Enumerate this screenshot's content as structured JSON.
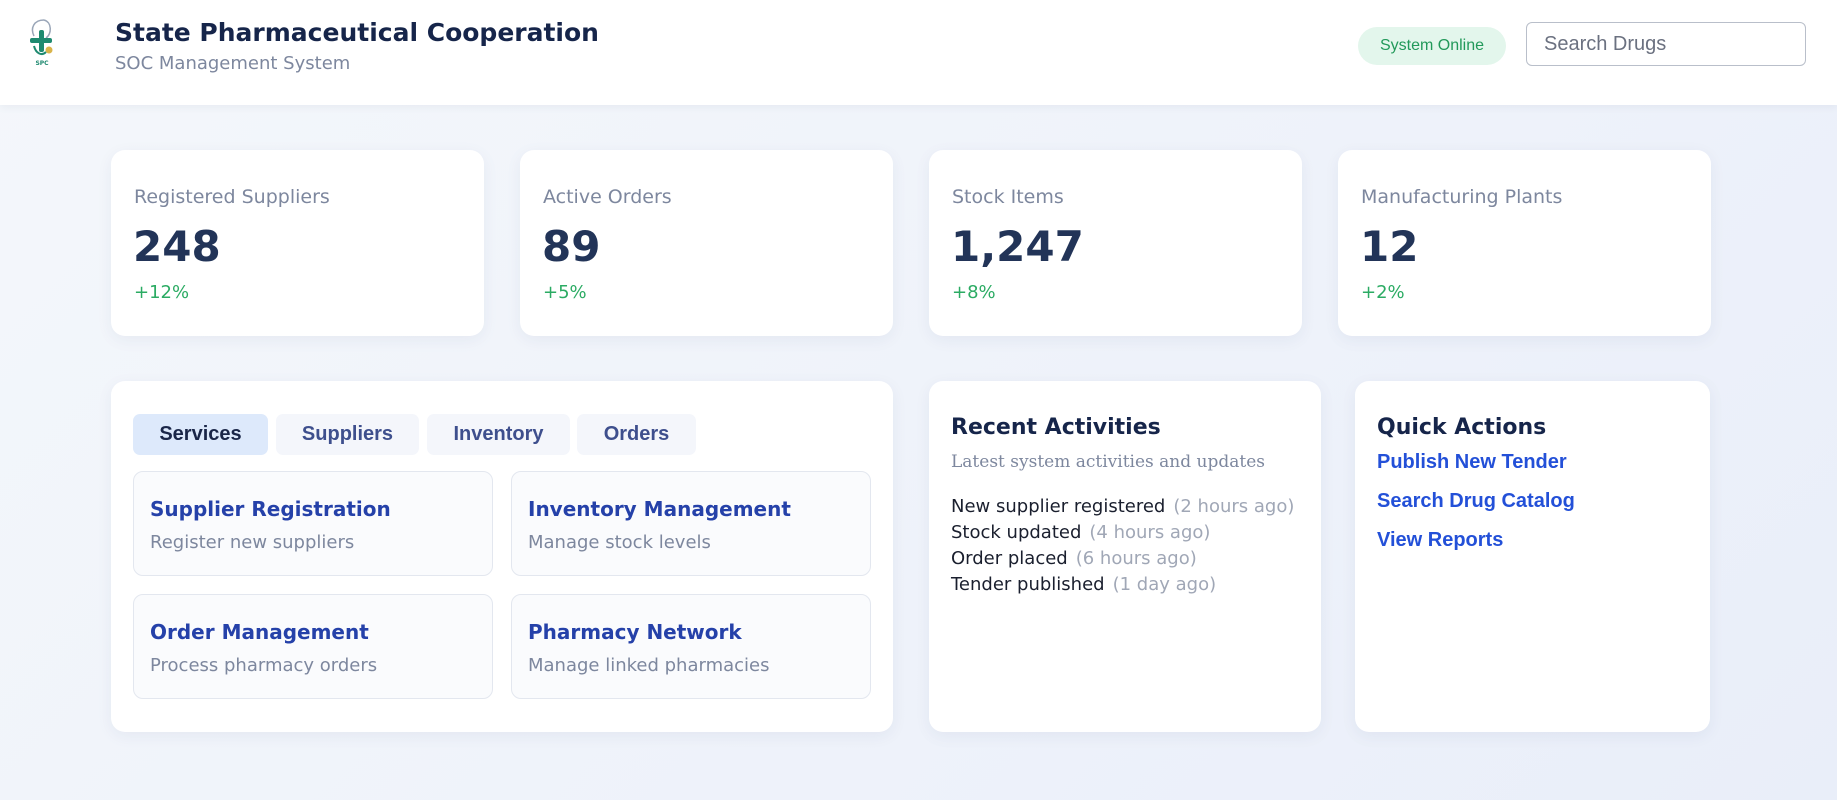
{
  "header": {
    "title": "State Pharmaceutical Cooperation",
    "subtitle": "SOC Management System",
    "logo_text": "SPC",
    "status": "System Online",
    "search_placeholder": "Search Drugs"
  },
  "stats": [
    {
      "label": "Registered Suppliers",
      "value": "248",
      "change": "+12%"
    },
    {
      "label": "Active Orders",
      "value": "89",
      "change": "+5%"
    },
    {
      "label": "Stock Items",
      "value": "1,247",
      "change": "+8%"
    },
    {
      "label": "Manufacturing Plants",
      "value": "12",
      "change": "+2%"
    }
  ],
  "tabs": [
    "Services",
    "Suppliers",
    "Inventory",
    "Orders"
  ],
  "services": [
    {
      "title": "Supplier Registration",
      "desc": "Register new suppliers"
    },
    {
      "title": "Inventory Management",
      "desc": "Manage stock levels"
    },
    {
      "title": "Order Management",
      "desc": "Process pharmacy orders"
    },
    {
      "title": "Pharmacy Network",
      "desc": "Manage linked pharmacies"
    }
  ],
  "activities": {
    "title": "Recent Activities",
    "subtitle": "Latest system activities and updates",
    "items": [
      {
        "text": "New supplier registered",
        "time": "(2 hours ago)"
      },
      {
        "text": "Stock updated",
        "time": "(4 hours ago)"
      },
      {
        "text": "Order placed",
        "time": "(6 hours ago)"
      },
      {
        "text": "Tender published",
        "time": "(1 day ago)"
      }
    ]
  },
  "quick_actions": {
    "title": "Quick Actions",
    "links": [
      "Publish New Tender",
      "Search Drug Catalog",
      "View Reports"
    ]
  },
  "colors": {
    "accent": "#2350d8",
    "status_green": "#22995a",
    "logo_green": "#1f8a70",
    "logo_gold": "#d9b44a"
  }
}
